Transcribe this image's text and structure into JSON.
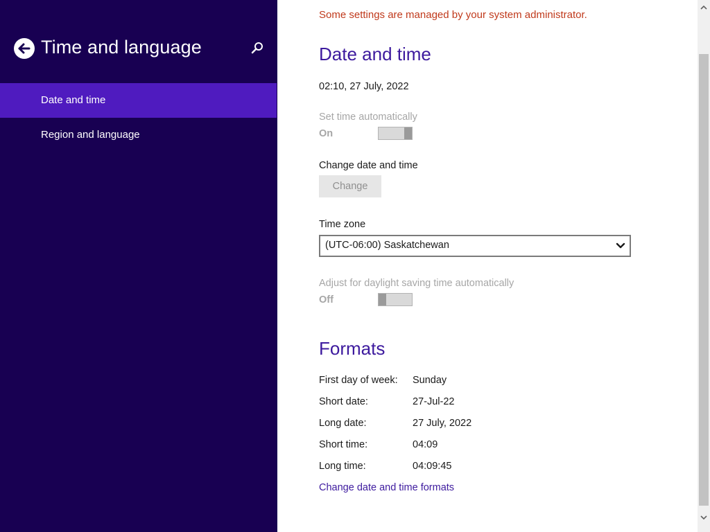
{
  "sidebar": {
    "title": "Time and language",
    "items": [
      {
        "label": "Date and time",
        "active": true
      },
      {
        "label": "Region and language",
        "active": false
      }
    ],
    "icons": {
      "back": "back-arrow-icon",
      "search": "search-icon"
    }
  },
  "main": {
    "admin_note": "Some settings are managed by your system administrator.",
    "date_time": {
      "heading": "Date and time",
      "current": "02:10, 27 July, 2022",
      "set_auto": {
        "label": "Set time automatically",
        "state": "On"
      },
      "change": {
        "label": "Change date and time",
        "button": "Change"
      },
      "timezone": {
        "label": "Time zone",
        "value": "(UTC-06:00) Saskatchewan"
      },
      "dst": {
        "label": "Adjust for daylight saving time automatically",
        "state": "Off"
      }
    },
    "formats": {
      "heading": "Formats",
      "rows": [
        {
          "label": "First day of week:",
          "value": "Sunday"
        },
        {
          "label": "Short date:",
          "value": "27-Jul-22"
        },
        {
          "label": "Long date:",
          "value": "27 July, 2022"
        },
        {
          "label": "Short time:",
          "value": "04:09"
        },
        {
          "label": "Long time:",
          "value": "04:09:45"
        }
      ],
      "link": "Change date and time formats"
    }
  },
  "colors": {
    "sidebar_bg": "#180052",
    "active_item": "#4f1bbf",
    "accent_heading": "#3d1a9e",
    "warning_text": "#c0391b"
  }
}
